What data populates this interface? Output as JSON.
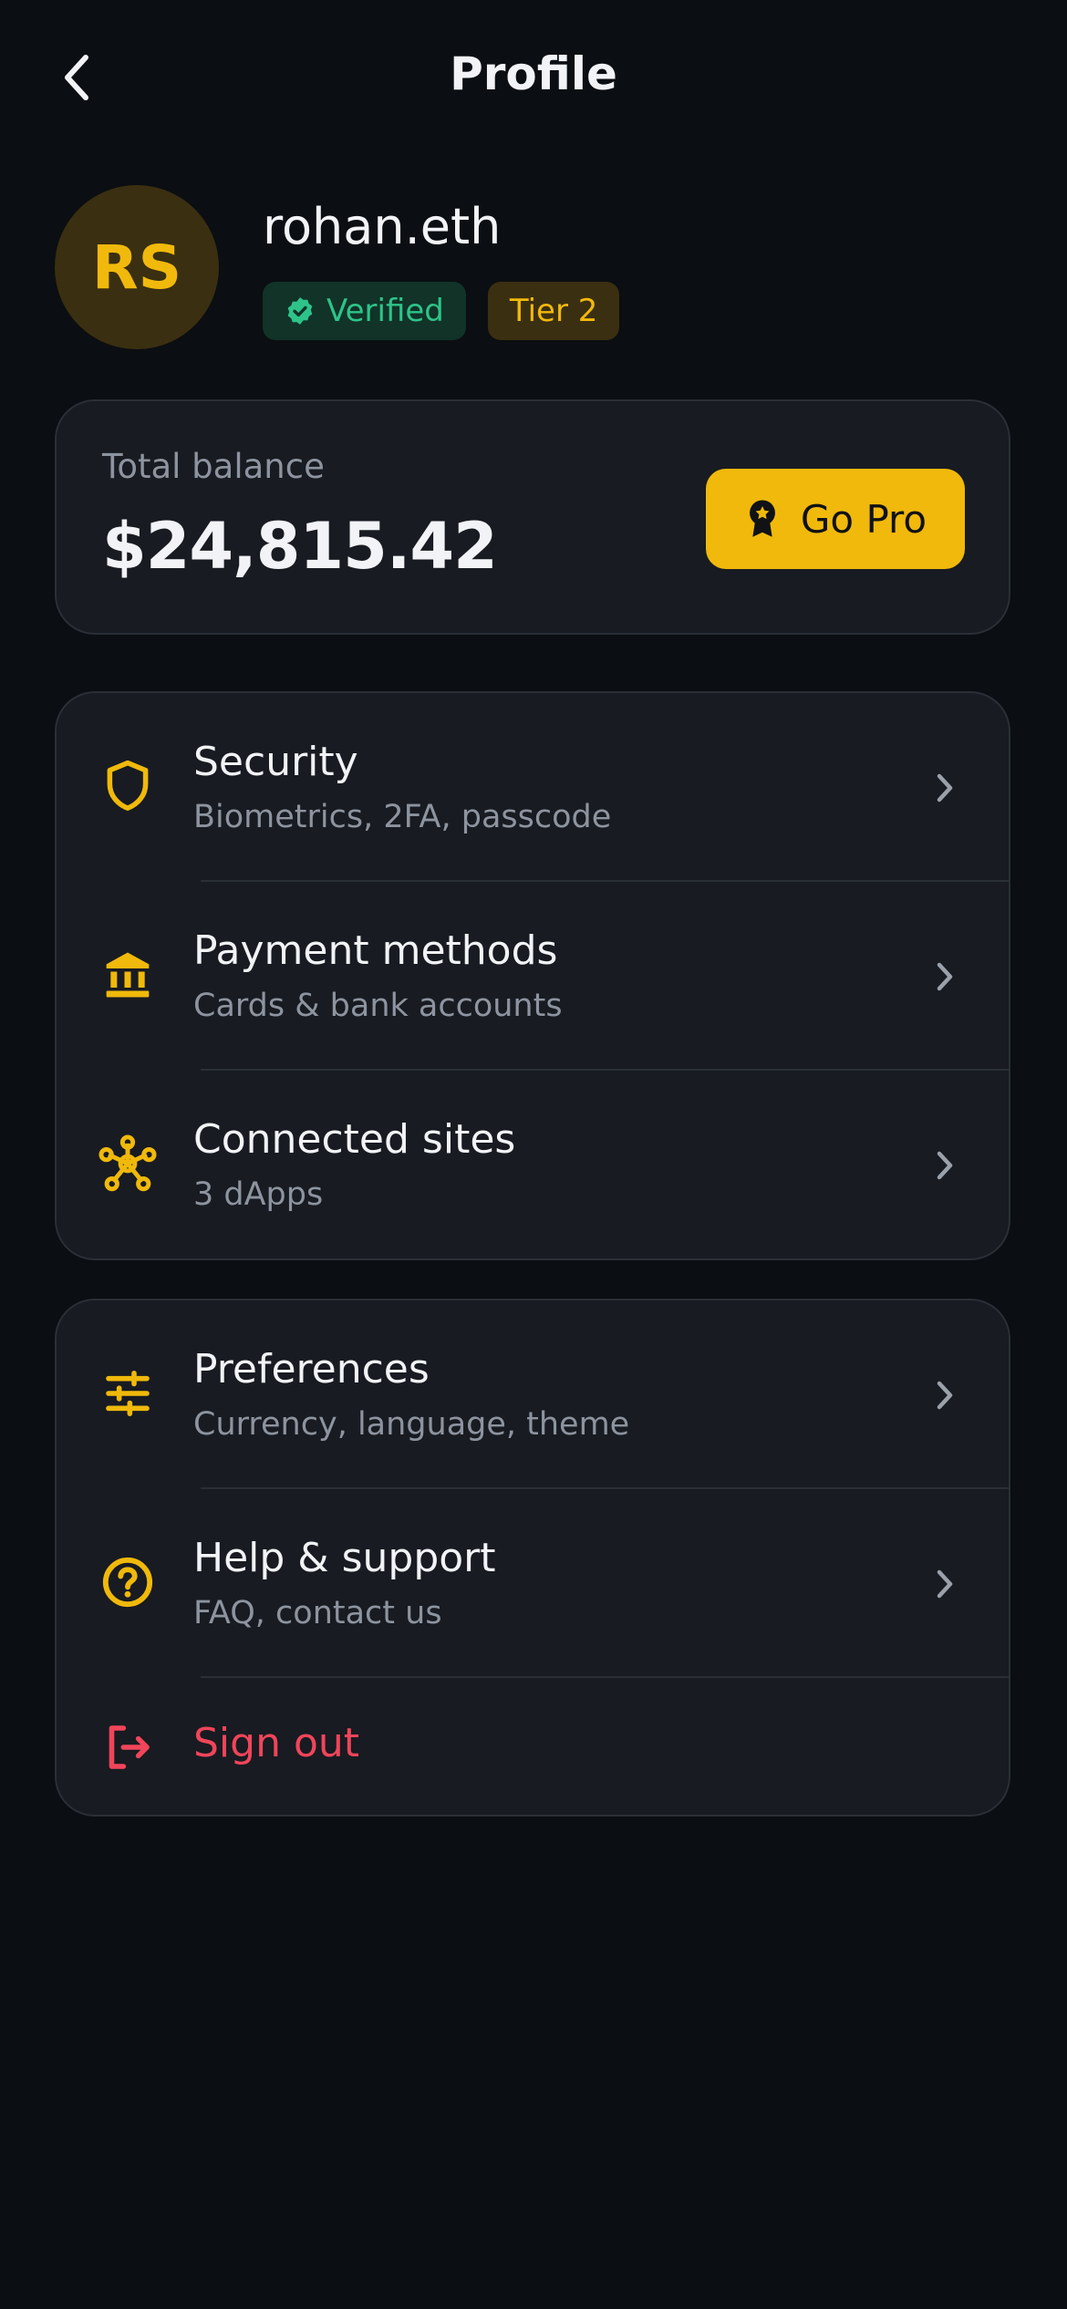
{
  "header": {
    "title": "Profile"
  },
  "profile": {
    "initials": "RS",
    "name": "rohan.eth",
    "verified_label": "Verified",
    "tier_label": "Tier 2"
  },
  "balance": {
    "label": "Total balance",
    "value": "$24,815.42",
    "cta": "Go Pro"
  },
  "account_menu": [
    {
      "title": "Security",
      "subtitle": "Biometrics, 2FA, passcode",
      "icon": "shield-icon"
    },
    {
      "title": "Payment methods",
      "subtitle": "Cards & bank accounts",
      "icon": "bank-icon"
    },
    {
      "title": "Connected sites",
      "subtitle": "3 dApps",
      "icon": "network-icon"
    }
  ],
  "settings_menu": [
    {
      "title": "Preferences",
      "subtitle": "Currency, language, theme",
      "icon": "sliders-icon"
    },
    {
      "title": "Help & support",
      "subtitle": "FAQ, contact us",
      "icon": "help-icon"
    }
  ],
  "signout": {
    "label": "Sign out",
    "icon": "logout-icon"
  },
  "colors": {
    "background": "#0b0e12",
    "card": "#181b21",
    "accent": "#f0b90b",
    "verified": "#2ec38a",
    "danger": "#f0455a",
    "muted": "#8d949f"
  }
}
